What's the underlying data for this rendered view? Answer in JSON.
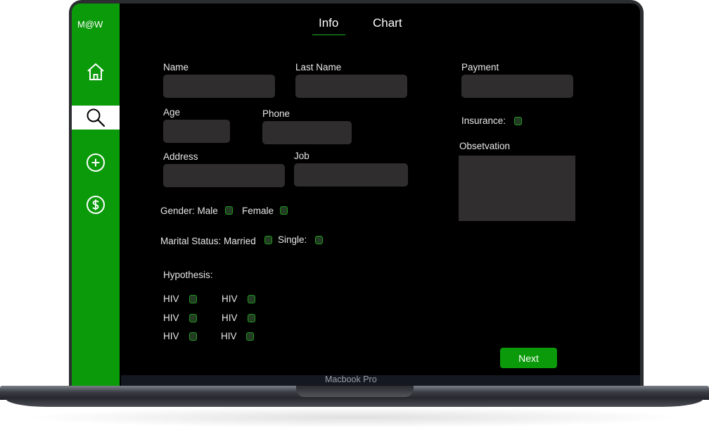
{
  "brand": "M@W",
  "tabs": [
    {
      "label": "Info"
    },
    {
      "label": "Chart"
    }
  ],
  "form": {
    "name": {
      "label": "Name",
      "value": ""
    },
    "last_name": {
      "label": "Last Name",
      "value": ""
    },
    "payment": {
      "label": "Payment",
      "value": ""
    },
    "age": {
      "label": "Age",
      "value": ""
    },
    "phone": {
      "label": "Phone",
      "value": ""
    },
    "insurance": {
      "label": "Insurance:"
    },
    "address": {
      "label": "Address",
      "value": ""
    },
    "job": {
      "label": "Job",
      "value": ""
    },
    "observation": {
      "label": "Obsetvation",
      "value": ""
    },
    "gender": {
      "label": "Gender: Male",
      "female": "Female"
    },
    "marital": {
      "label": "Marital Status: Married",
      "single": "Single:"
    },
    "hypothesis": {
      "label": "Hypothesis:",
      "items": [
        "HIV",
        "HIV",
        "HIV",
        "HIV",
        "HIV",
        "HIV"
      ]
    }
  },
  "next_label": "Next",
  "device_label": "Macbook Pro",
  "colors": {
    "accent": "#0a9a0a",
    "field": "#2f2d2d",
    "screen": "#000000"
  },
  "icons": [
    "home-icon",
    "search-icon",
    "plus-circle-icon",
    "dollar-circle-icon"
  ]
}
